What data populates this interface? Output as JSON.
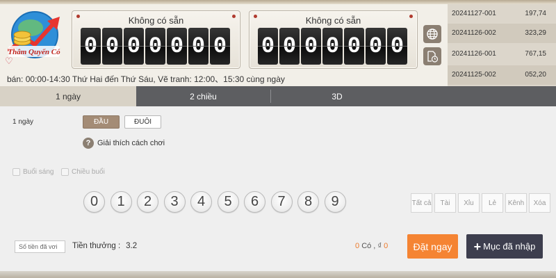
{
  "logo": {
    "text": "Thâm Quyến Có"
  },
  "panels": [
    {
      "title": "Không có sẵn",
      "digits": [
        "0",
        "0",
        "0",
        "0",
        "0",
        "0",
        "0"
      ]
    },
    {
      "title": "Không có sẵn",
      "digits": [
        "0",
        "0",
        "0",
        "0",
        "0",
        "0",
        "0"
      ]
    }
  ],
  "icons": {
    "web": "globe-icon",
    "history": "document-clock-icon",
    "favorite": "heart-icon",
    "help": "question-icon",
    "add": "plus-icon"
  },
  "history": [
    {
      "id": "20241127-001",
      "value": "197,74"
    },
    {
      "id": "20241126-002",
      "value": "323,29"
    },
    {
      "id": "20241126-001",
      "value": "767,15"
    },
    {
      "id": "20241125-002",
      "value": "052,20"
    }
  ],
  "schedule": "bán: 00:00-14:30 Thứ Hai đến Thứ Sáu,   Vẽ tranh: 12:00、15:30 cùng ngày",
  "tabs": [
    {
      "label": "1 ngày"
    },
    {
      "label": "2 chiều"
    },
    {
      "label": "3D"
    }
  ],
  "main": {
    "mode_label": "1 ngày",
    "position_buttons": [
      "ĐẦU",
      "ĐUÔI"
    ],
    "help_text": "Giải thích cách chơi",
    "checkboxes": [
      "Buổi sáng",
      "Chiều buổi"
    ],
    "numbers": [
      "0",
      "1",
      "2",
      "3",
      "4",
      "5",
      "6",
      "7",
      "8",
      "9"
    ],
    "quick_select": [
      "Tất cả",
      "Tài",
      "Xỉu",
      "Lẻ",
      "Kênh",
      "Xóa"
    ],
    "amount_placeholder": "Số tiền đã vơi",
    "prize_label": "Tiền thưởng :",
    "prize_value": "3.2",
    "count_num": "0",
    "count_label": "Có ,",
    "currency_symbol": "₫",
    "money_num": "0",
    "bet_button": "Đặt ngay",
    "cart_button": "Mục đã nhập"
  },
  "colors": {
    "accent_orange": "#f58433",
    "dark_button": "#3d3e4e",
    "tab_bar": "#5d5e61",
    "brown_active": "#a48c76"
  }
}
